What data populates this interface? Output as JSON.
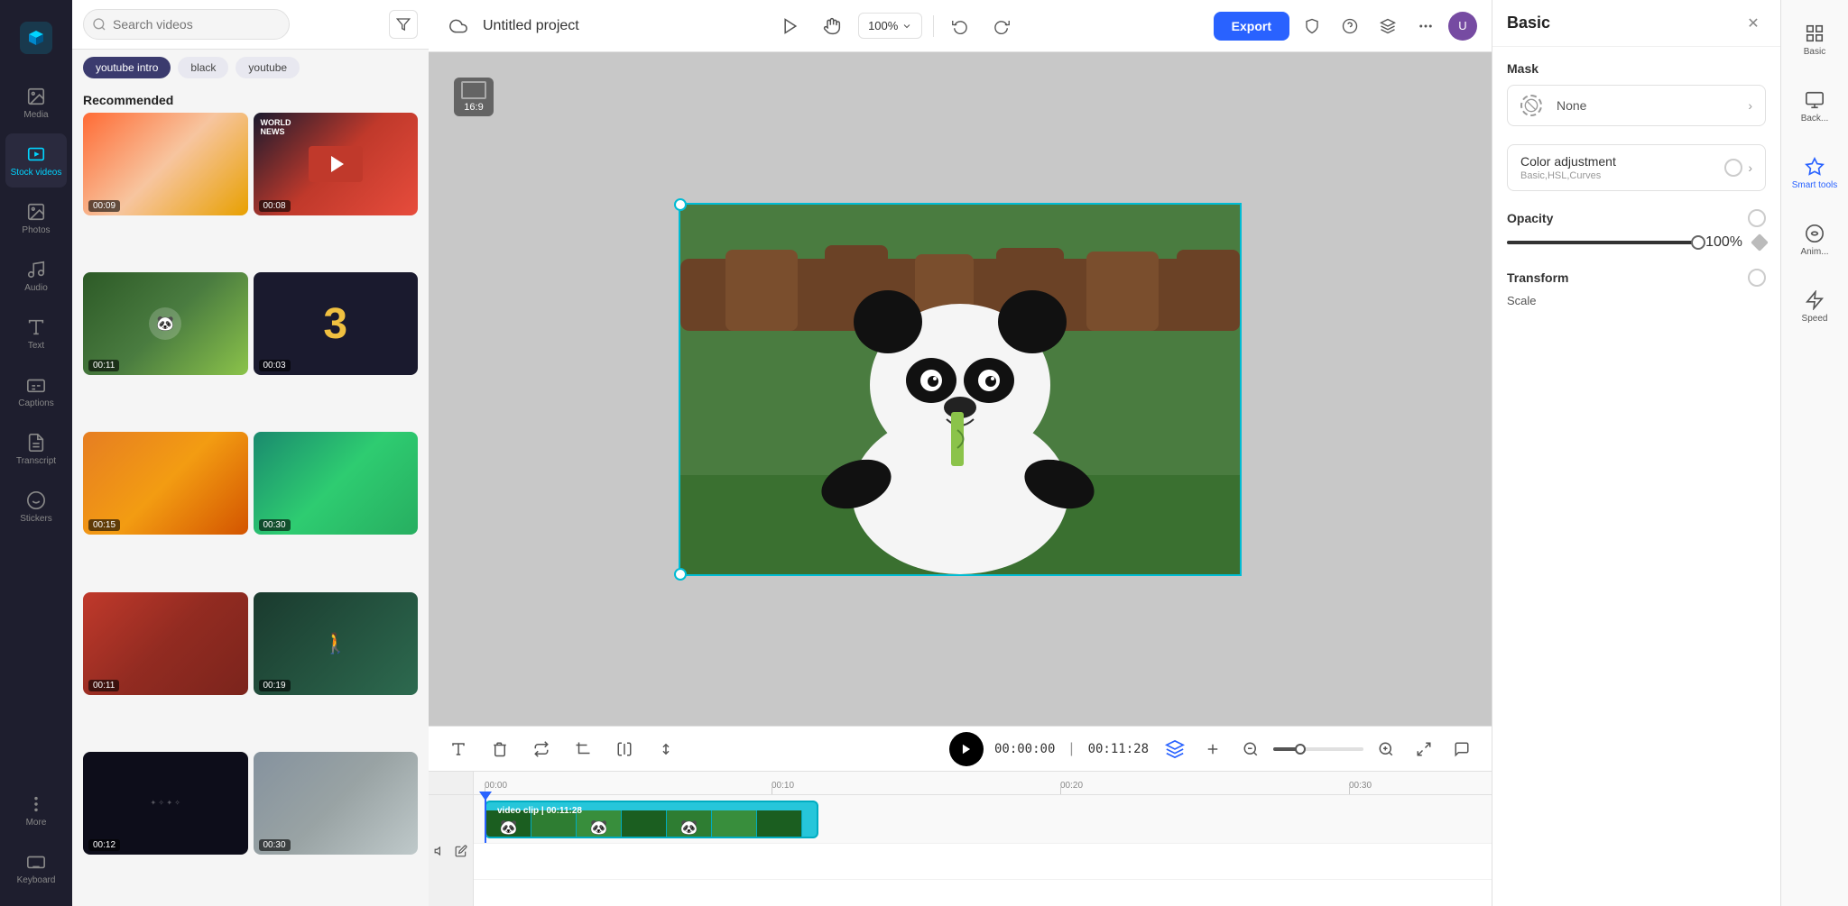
{
  "app": {
    "logo_text": "✂",
    "title": "Untitled project"
  },
  "left_nav": {
    "items": [
      {
        "id": "media",
        "label": "Media",
        "icon": "media"
      },
      {
        "id": "stock_videos",
        "label": "Stock videos",
        "icon": "stock-videos",
        "active": true
      },
      {
        "id": "photos",
        "label": "Photos",
        "icon": "photos"
      },
      {
        "id": "audio",
        "label": "Audio",
        "icon": "audio"
      },
      {
        "id": "text",
        "label": "Text",
        "icon": "text"
      },
      {
        "id": "captions",
        "label": "Captions",
        "icon": "captions"
      },
      {
        "id": "transcript",
        "label": "Transcript",
        "icon": "transcript"
      },
      {
        "id": "stickers",
        "label": "Stickers",
        "icon": "stickers"
      },
      {
        "id": "more",
        "label": "More",
        "icon": "more"
      },
      {
        "id": "keyboard",
        "label": "Keyboard",
        "icon": "keyboard"
      }
    ]
  },
  "search": {
    "placeholder": "Search videos",
    "filter_label": "Filter"
  },
  "tags": [
    {
      "id": "youtube_intro",
      "label": "youtube intro",
      "active": true
    },
    {
      "id": "black",
      "label": "black"
    },
    {
      "id": "youtube",
      "label": "youtube"
    }
  ],
  "videos": {
    "section_label": "Recommended",
    "items": [
      {
        "id": 1,
        "duration": "00:09",
        "thumb_class": "thumb-1"
      },
      {
        "id": 2,
        "duration": "00:08",
        "thumb_class": "thumb-2"
      },
      {
        "id": 3,
        "duration": "00:11",
        "thumb_class": "thumb-3"
      },
      {
        "id": 4,
        "duration": "00:03",
        "thumb_class": "thumb-4",
        "number": "3"
      },
      {
        "id": 5,
        "duration": "00:15",
        "thumb_class": "thumb-5"
      },
      {
        "id": 6,
        "duration": "00:30",
        "thumb_class": "thumb-6"
      },
      {
        "id": 7,
        "duration": "00:11",
        "thumb_class": "thumb-7"
      },
      {
        "id": 8,
        "duration": "00:19",
        "thumb_class": "thumb-8"
      },
      {
        "id": 9,
        "duration": "00:12",
        "thumb_class": "thumb-9"
      },
      {
        "id": 10,
        "duration": "00:30",
        "thumb_class": "thumb-10"
      }
    ]
  },
  "header": {
    "title": "Untitled project",
    "zoom": "100%",
    "export_label": "Export"
  },
  "canvas": {
    "aspect_ratio": "16:9"
  },
  "timeline": {
    "current_time": "00:00:00",
    "total_time": "00:11:28",
    "clip_label": "video clip | 00:11:28",
    "markers": [
      "00:00",
      "00:10",
      "00:20",
      "00:30"
    ],
    "play_btn": "Play"
  },
  "right_panel": {
    "title": "Basic",
    "mask_label": "Mask",
    "mask_value": "None",
    "color_adjustment_label": "Color adjustment",
    "color_adjustment_sub": "Basic,HSL,Curves",
    "opacity_label": "Opacity",
    "opacity_value": "100%",
    "transform_label": "Transform",
    "scale_label": "Scale"
  },
  "smart_tools": {
    "items": [
      {
        "id": "basic",
        "label": "Basic",
        "active": false
      },
      {
        "id": "background",
        "label": "Back...",
        "active": false
      },
      {
        "id": "smart",
        "label": "Smart tools",
        "active": false
      },
      {
        "id": "animation",
        "label": "Anim...",
        "active": false
      },
      {
        "id": "speed",
        "label": "Speed",
        "active": false
      }
    ]
  }
}
